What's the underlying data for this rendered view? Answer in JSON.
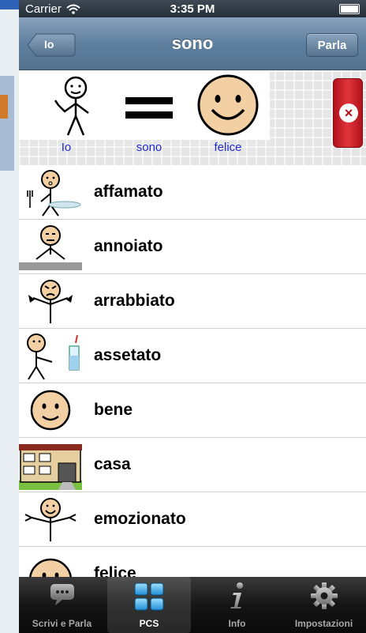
{
  "status_bar": {
    "carrier": "Carrier",
    "time": "3:35 PM"
  },
  "nav": {
    "back_label": "Io",
    "title": "sono",
    "speak_label": "Parla"
  },
  "sentence": {
    "words": [
      "Io",
      "sono",
      "felice"
    ],
    "clear_icon": "close-circle-icon"
  },
  "list": {
    "items": [
      {
        "label": "affamato",
        "icon": "hungry-symbol"
      },
      {
        "label": "annoiato",
        "icon": "bored-symbol"
      },
      {
        "label": "arrabbiato",
        "icon": "angry-symbol"
      },
      {
        "label": "assetato",
        "icon": "thirsty-symbol"
      },
      {
        "label": "bene",
        "icon": "smiley-symbol"
      },
      {
        "label": "casa",
        "icon": "house-symbol"
      },
      {
        "label": "emozionato",
        "icon": "excited-symbol"
      },
      {
        "label": "felice",
        "icon": "happy-symbol"
      }
    ]
  },
  "tabs": [
    {
      "label": "Scrivi e Parla",
      "icon": "speech-bubble-icon",
      "selected": false
    },
    {
      "label": "PCS",
      "icon": "grid-icon",
      "selected": true
    },
    {
      "label": "Info",
      "icon": "info-icon",
      "selected": false
    },
    {
      "label": "Impostazioni",
      "icon": "gear-icon",
      "selected": false
    }
  ],
  "colors": {
    "nav": "#6d8aa8",
    "word_label": "#1f2ad3",
    "clear_button": "#c8202a",
    "tab_bar": "#1a1a1a"
  }
}
